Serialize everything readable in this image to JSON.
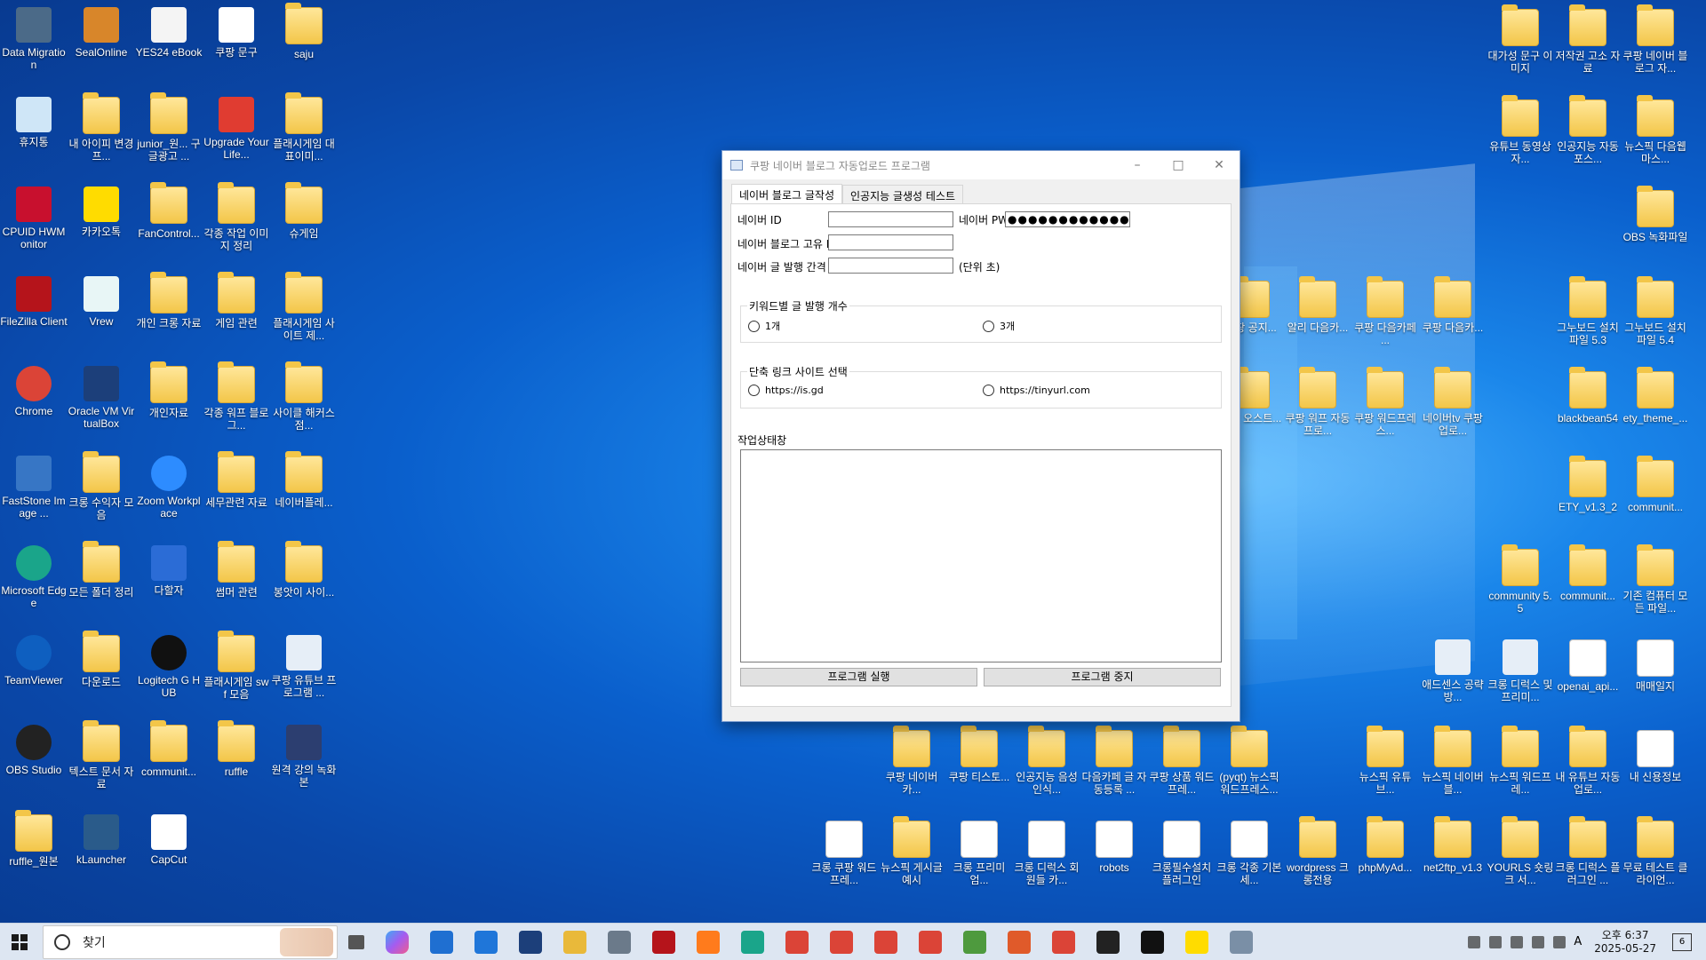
{
  "window": {
    "title": "쿠팡 네이버 블로그 자동업로드 프로그램",
    "tabs": [
      {
        "label": "네이버 블로그 글작성"
      },
      {
        "label": "인공지능 글생성 테스트"
      }
    ],
    "fields": {
      "naver_id_label": "네이버 ID",
      "naver_id_value": "",
      "naver_pw_label": "네이버 PW",
      "naver_pw_value": "●●●●●●●●●●●●",
      "blog_id_label": "네이버 블로그 고유 ID",
      "blog_id_value": "",
      "interval_label": "네이버 글 발행 간격",
      "interval_value": "",
      "interval_unit": "(단위 초)"
    },
    "keyword_group": {
      "title": "키워드별 글 발행 개수",
      "options": [
        "1개",
        "3개"
      ]
    },
    "shortlink_group": {
      "title": "단축 링크 사이트 선택",
      "options": [
        "https://is.gd",
        "https://tinyurl.com"
      ]
    },
    "status_label": "작업상태창",
    "buttons": {
      "run": "프로그램 실행",
      "stop": "프로그램 중지"
    }
  },
  "desktop_icons_left": [
    {
      "label": "Data Migration",
      "icon": "data-migration-icon"
    },
    {
      "label": "SealOnline",
      "icon": "sealonline-icon"
    },
    {
      "label": "YES24 eBook",
      "icon": "yes24-icon"
    },
    {
      "label": "쿠팡 문구",
      "icon": "ppt-icon"
    },
    {
      "label": "saju",
      "icon": "folder-icon"
    },
    {
      "label": "휴지통",
      "icon": "recycle-bin-icon"
    },
    {
      "label": "내 아이피 변경 프...",
      "icon": "folder-icon"
    },
    {
      "label": "junior_원... 구글광고 ...",
      "icon": "folder-icon"
    },
    {
      "label": "Upgrade Your Life...",
      "icon": "upgrade-icon"
    },
    {
      "label": "플래시게임 대표이미...",
      "icon": "folder-icon"
    },
    {
      "label": "CPUID HWMonitor",
      "icon": "hwmonitor-icon"
    },
    {
      "label": "카카오톡",
      "icon": "kakaotalk-icon"
    },
    {
      "label": "FanControl...",
      "icon": "folder-icon"
    },
    {
      "label": "각종 작업 이미지 정리",
      "icon": "folder-icon"
    },
    {
      "label": "슈게임",
      "icon": "folder-icon"
    },
    {
      "label": "FileZilla Client",
      "icon": "filezilla-icon"
    },
    {
      "label": "Vrew",
      "icon": "vrew-icon"
    },
    {
      "label": "개인 크롱 자료",
      "icon": "folder-icon"
    },
    {
      "label": "게임 관련",
      "icon": "folder-icon"
    },
    {
      "label": "플래시게임 사이트 제...",
      "icon": "folder-icon"
    },
    {
      "label": "Chrome",
      "icon": "chrome-icon"
    },
    {
      "label": "Oracle VM VirtualBox",
      "icon": "virtualbox-icon"
    },
    {
      "label": "개인자료",
      "icon": "folder-icon"
    },
    {
      "label": "각종 워프 블로그...",
      "icon": "folder-icon"
    },
    {
      "label": "사이클 해커스 점...",
      "icon": "folder-icon"
    },
    {
      "label": "FastStone Image ...",
      "icon": "faststone-icon"
    },
    {
      "label": "크롱 수익자 모음",
      "icon": "folder-icon"
    },
    {
      "label": "Zoom Workplace",
      "icon": "zoom-icon"
    },
    {
      "label": "세무관련 자료",
      "icon": "folder-icon"
    },
    {
      "label": "네이버플레...",
      "icon": "folder-icon"
    },
    {
      "label": "Microsoft Edge",
      "icon": "edge-icon"
    },
    {
      "label": "모든 폴더 정리",
      "icon": "folder-icon"
    },
    {
      "label": "다할자",
      "icon": "da-icon"
    },
    {
      "label": "썸머 관련",
      "icon": "folder-icon"
    },
    {
      "label": "봉앗이 사이...",
      "icon": "folder-icon"
    },
    {
      "label": "TeamViewer",
      "icon": "teamviewer-icon"
    },
    {
      "label": "다운로드",
      "icon": "folder-icon"
    },
    {
      "label": "Logitech G HUB",
      "icon": "logitech-icon"
    },
    {
      "label": "플래시게임 swf 모음",
      "icon": "folder-icon"
    },
    {
      "label": "쿠팡 유튜브 프로그램 ...",
      "icon": "program-icon"
    },
    {
      "label": "OBS Studio",
      "icon": "obs-icon"
    },
    {
      "label": "텍스트 문서 자료",
      "icon": "folder-icon"
    },
    {
      "label": "communit...",
      "icon": "folder-icon"
    },
    {
      "label": "ruffle",
      "icon": "folder-icon"
    },
    {
      "label": "원격 강의 녹화본",
      "icon": "video-icon"
    },
    {
      "label": "ruffle_원본",
      "icon": "folder-icon"
    },
    {
      "label": "kLauncher",
      "icon": "klauncher-icon"
    },
    {
      "label": "CapCut",
      "icon": "capcut-icon"
    }
  ],
  "desktop_icons_right": [
    {
      "label": "대가성 문구 이미지",
      "icon": "folder-icon"
    },
    {
      "label": "저작권 고소 자료",
      "icon": "folder-icon"
    },
    {
      "label": "쿠팡 네이버 블로그 자...",
      "icon": "folder-icon"
    },
    {
      "label": "유튜브 동영상 자...",
      "icon": "folder-icon"
    },
    {
      "label": "인공지능 자동포스...",
      "icon": "folder-icon"
    },
    {
      "label": "뉴스픽 다음웹마스...",
      "icon": "folder-icon"
    },
    {
      "label": "OBS 녹화파일",
      "icon": "folder-icon"
    },
    {
      "label": "그누보드 설치파일 5.3",
      "icon": "folder-icon"
    },
    {
      "label": "그누보드 설치파일 5.4",
      "icon": "folder-icon"
    },
    {
      "label": "blackbean54",
      "icon": "folder-icon"
    },
    {
      "label": "ety_theme_...",
      "icon": "folder-icon"
    },
    {
      "label": "ETY_v1.3_2",
      "icon": "folder-icon"
    },
    {
      "label": "communit...",
      "icon": "folder-icon"
    },
    {
      "label": "community 5.5",
      "icon": "folder-icon"
    },
    {
      "label": "communit...",
      "icon": "folder-icon"
    },
    {
      "label": "기존 컴퓨터 모든 파일...",
      "icon": "folder-icon"
    },
    {
      "label": "애드센스 공략 방...",
      "icon": "program-icon"
    },
    {
      "label": "크롱 디럭스 및 프리미...",
      "icon": "program-icon"
    },
    {
      "label": "openai_api...",
      "icon": "doc-icon"
    },
    {
      "label": "매매일지",
      "icon": "doc-icon"
    }
  ],
  "desktop_icons_mid": [
    {
      "label": "쿠팡 공지...",
      "icon": "folder-icon"
    },
    {
      "label": "알리 다음카...",
      "icon": "folder-icon"
    },
    {
      "label": "쿠팡 다음카페 ...",
      "icon": "folder-icon"
    },
    {
      "label": "쿠팡 다음카...",
      "icon": "folder-icon"
    },
    {
      "label": "알리 오스트...",
      "icon": "folder-icon"
    },
    {
      "label": "쿠팡 워프 자동 프로...",
      "icon": "folder-icon"
    },
    {
      "label": "쿠팡 워드프레스...",
      "icon": "folder-icon"
    },
    {
      "label": "네이버tv 쿠팡 업로...",
      "icon": "folder-icon"
    }
  ],
  "desktop_icons_bottom1": [
    {
      "label": "쿠팡 네이버카...",
      "icon": "folder-icon"
    },
    {
      "label": "쿠팡 티스토...",
      "icon": "folder-icon"
    },
    {
      "label": "인공지능 음성인식...",
      "icon": "folder-icon"
    },
    {
      "label": "다음카페 글 자동등록 ...",
      "icon": "folder-icon"
    },
    {
      "label": "쿠팡 상품 워드프레...",
      "icon": "folder-icon"
    },
    {
      "label": "(pyqt) 뉴스픽 워드프레스...",
      "icon": "folder-icon"
    },
    {
      "label": "뉴스픽 유튜브...",
      "icon": "folder-icon"
    },
    {
      "label": "뉴스픽 네이버블...",
      "icon": "folder-icon"
    },
    {
      "label": "뉴스픽 워드프레...",
      "icon": "folder-icon"
    },
    {
      "label": "내 유튜브 자동업로...",
      "icon": "folder-icon"
    },
    {
      "label": "내 신용정보",
      "icon": "doc-icon"
    }
  ],
  "desktop_icons_bottom2": [
    {
      "label": "크롱 쿠팡 워드프레...",
      "icon": "doc-icon"
    },
    {
      "label": "뉴스픽 게시글 예시",
      "icon": "folder-icon"
    },
    {
      "label": "크롱 프리미엄...",
      "icon": "doc-icon"
    },
    {
      "label": "크롱 디럭스 회원들 카...",
      "icon": "doc-icon"
    },
    {
      "label": "robots",
      "icon": "doc-icon"
    },
    {
      "label": "크롱필수설치 플러그인",
      "icon": "doc-icon"
    },
    {
      "label": "크롱 각종 기본 세...",
      "icon": "doc-icon"
    },
    {
      "label": "wordpress 크롱전용",
      "icon": "folder-icon"
    },
    {
      "label": "phpMyAd...",
      "icon": "folder-icon"
    },
    {
      "label": "net2ftp_v1.3",
      "icon": "folder-icon"
    },
    {
      "label": "YOURLS 숏링크 서...",
      "icon": "folder-icon"
    },
    {
      "label": "크롱 디럭스 플러그인 ...",
      "icon": "folder-icon"
    },
    {
      "label": "무료 테스트 클라이언...",
      "icon": "folder-icon"
    }
  ],
  "taskbar": {
    "search_placeholder": "찾기",
    "clock_time": "오후 6:37",
    "clock_date": "2025-05-27",
    "ime": "A",
    "notifications": "6"
  }
}
